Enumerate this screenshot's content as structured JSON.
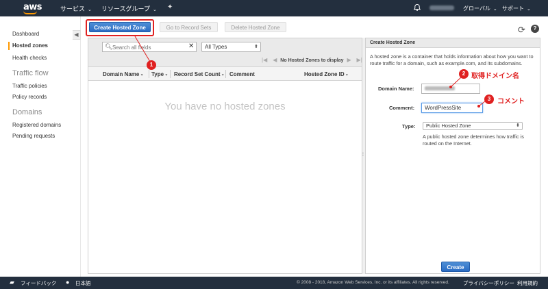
{
  "topnav": {
    "logo": "aws",
    "services": "サービス",
    "resource_groups": "リソースグループ",
    "region": "グローバル",
    "support": "サポート",
    "caret": "⌄"
  },
  "sidebar": {
    "items": [
      {
        "label": "Dashboard"
      },
      {
        "label": "Hosted zones",
        "active": true
      },
      {
        "label": "Health checks"
      }
    ],
    "traffic_heading": "Traffic flow",
    "traffic_items": [
      {
        "label": "Traffic policies"
      },
      {
        "label": "Policy records"
      }
    ],
    "domains_heading": "Domains",
    "domain_items": [
      {
        "label": "Registered domains"
      },
      {
        "label": "Pending requests"
      }
    ]
  },
  "toolbar": {
    "create_label": "Create Hosted Zone",
    "goto_label": "Go to Record Sets",
    "delete_label": "Delete Hosted Zone"
  },
  "filter": {
    "search_placeholder": "Search all fields",
    "type_selected": "All Types",
    "pager_text": "No Hosted Zones to display"
  },
  "table": {
    "columns": [
      "Domain Name",
      "Type",
      "Record Set Count",
      "Comment",
      "Hosted Zone ID"
    ],
    "empty_message": "You have no hosted zones"
  },
  "form": {
    "title": "Create Hosted Zone",
    "description": "A hosted zone is a container that holds information about how you want to route traffic for a domain, such as example.com, and its subdomains.",
    "domain_label": "Domain Name:",
    "comment_label": "Comment:",
    "comment_value": "WordPressSite",
    "type_label": "Type:",
    "type_value": "Public Hosted Zone",
    "type_help": "A public hosted zone determines how traffic is routed on the Internet.",
    "submit_label": "Create"
  },
  "annotations": {
    "badge1": "1",
    "badge2": "2",
    "badge3": "3",
    "note2": "取得ドメイン名",
    "note3": "コメント"
  },
  "footer": {
    "feedback": "フィードバック",
    "language": "日本語",
    "copyright": "© 2008 - 2018, Amazon Web Services, Inc. or its affiliates. All rights reserved.",
    "privacy": "プライバシーポリシー",
    "terms": "利用規約"
  },
  "colors": {
    "nav_bg": "#232f3e",
    "accent": "#ff9900",
    "primary_button": "#2b6cc4",
    "annotation_red": "#e02020"
  },
  "icons": [
    "bell-icon",
    "pin-icon",
    "refresh-icon",
    "help-icon",
    "search-icon",
    "clear-icon",
    "chat-icon",
    "globe-icon"
  ]
}
